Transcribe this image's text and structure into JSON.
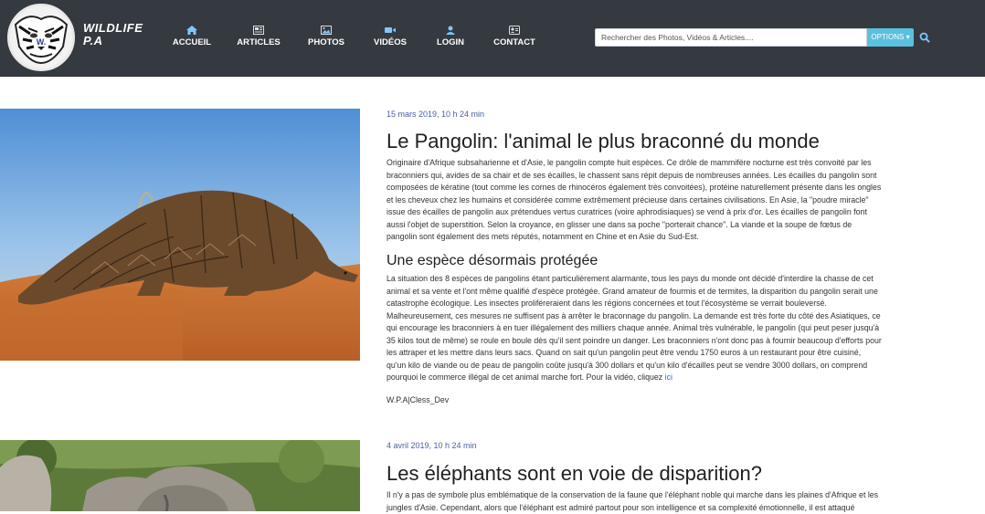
{
  "brand": {
    "line1": "WILDLIFE",
    "line2": "P.A"
  },
  "nav": [
    {
      "label": "ACCUEIL",
      "icon": "home-icon"
    },
    {
      "label": "ARTICLES",
      "icon": "newspaper-icon"
    },
    {
      "label": "PHOTOS",
      "icon": "image-icon"
    },
    {
      "label": "VIDÉOS",
      "icon": "video-icon"
    },
    {
      "label": "LOGIN",
      "icon": "user-icon"
    },
    {
      "label": "CONTACT",
      "icon": "contact-card-icon"
    }
  ],
  "search": {
    "placeholder": "Rechercher des Photos, Vidéos & Articles....",
    "options_label": "OPTIONS"
  },
  "articles": [
    {
      "date": "15 mars 2019, 10 h 24 min",
      "title": "Le Pangolin: l'animal le plus braconné du monde",
      "para1": "Originaire d'Afrique subsaharienne et d'Asie, le pangolin compte huit espèces. Ce drôle de mammifère nocturne est très convoité par les braconniers qui, avides de sa chair et de ses écailles, le chassent sans répit depuis de nombreuses années. Les écailles du pangolin sont composées de kératine (tout comme les cornes de rhinocéros également très convoitées), protéine naturellement présente dans les ongles et les cheveux chez les humains et considérée comme extrêmement précieuse dans certaines civilisations. En Asie, la \"poudre miracle\" issue des écailles de pangolin aux prétendues vertus curatrices (voire aphrodisiaques) se vend à prix d'or. Les écailles de pangolin font aussi l'objet de superstition. Selon la croyance, en glisser une dans sa poche \"porterait chance\". La viande et la soupe de fœtus de pangolin sont également des mets réputés, notamment en Chine et en Asie du Sud-Est.",
      "subtitle": "Une espèce désormais protégée",
      "para2": "La situation des 8 espèces de pangolins étant particulièrement alarmante, tous les pays du monde ont décidé d'interdire la chasse de cet animal et sa vente et l'ont même qualifié d'espèce protégée. Grand amateur de fourmis et de termites, la disparition du pangolin serait une catastrophe écologique. Les insectes proliféreraient dans les régions concernées et tout l'écosystème se verrait bouleversé. Malheureusement, ces mesures ne suffisent pas à arrêter le braconnage du pangolin. La demande est très forte du côté des Asiatiques, ce qui encourage les braconniers à en tuer illégalement des milliers chaque année. Animal très vulnérable, le pangolin (qui peut peser jusqu'à 35 kilos tout de même) se roule en boule dès qu'il sent poindre un danger. Les braconniers n'ont donc pas à fournir beaucoup d'efforts pour les attraper et les mettre dans leurs sacs. Quand on sait qu'un pangolin peut être vendu 1750 euros à un restaurant pour être cuisiné, qu'un kilo de viande ou de peau de pangolin coûte jusqu'à 300 dollars et qu'un kilo d'écailles peut se vendre 3000 dollars, on comprend pourquoi le commerce illégal de cet animal marche fort. Pour la vidéo, cliquez",
      "link": "ici",
      "author": "W.P.A|Cless_Dev"
    },
    {
      "date": "4 avril 2019, 10 h 24 min",
      "title": "Les éléphants sont en voie de disparition?",
      "para1": "Il n'y a pas de symbole plus emblématique de la conservation de la faune que l'éléphant noble qui marche dans les plaines d'Afrique et les jungles d'Asie. Cependant, alors que l'éléphant est admiré partout pour son intelligence et sa complexité émotionnelle, il est attaqué"
    }
  ],
  "colors": {
    "navbar": "#343a40",
    "accent": "#5bc0de",
    "date": "#4a5ea8",
    "link": "#2a6fd1"
  }
}
